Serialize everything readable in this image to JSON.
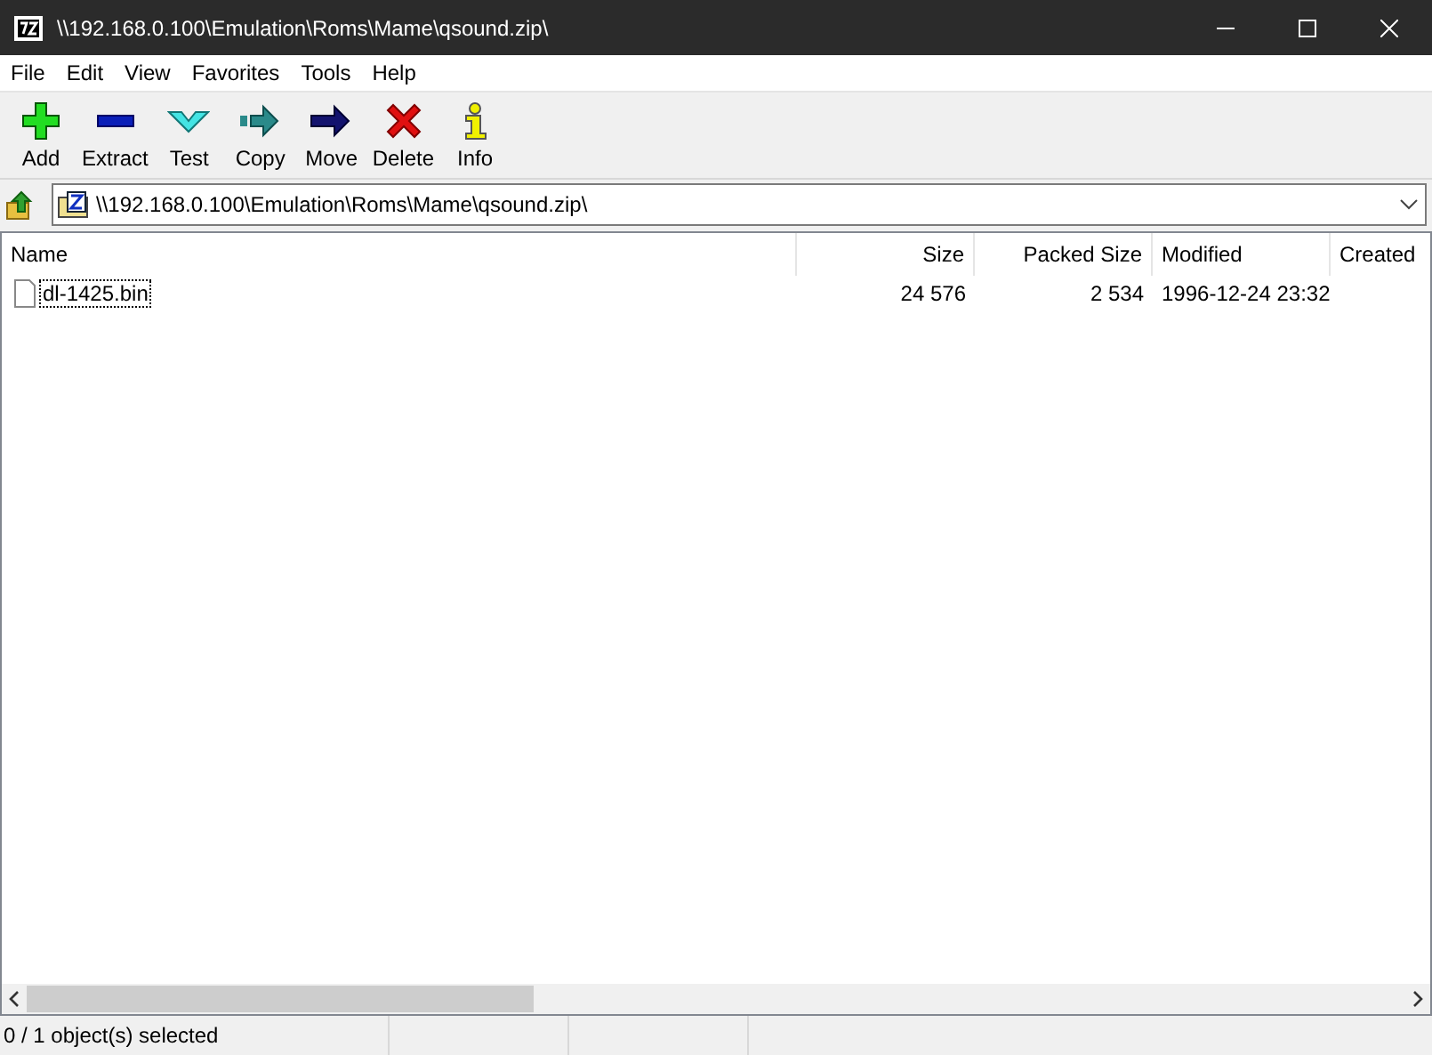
{
  "window": {
    "title": "\\\\192.168.0.100\\Emulation\\Roms\\Mame\\qsound.zip\\"
  },
  "menu": [
    "File",
    "Edit",
    "View",
    "Favorites",
    "Tools",
    "Help"
  ],
  "toolbar": [
    {
      "kind": "add",
      "label": "Add"
    },
    {
      "kind": "extract",
      "label": "Extract"
    },
    {
      "kind": "test",
      "label": "Test"
    },
    {
      "kind": "copy",
      "label": "Copy"
    },
    {
      "kind": "move",
      "label": "Move"
    },
    {
      "kind": "delete",
      "label": "Delete"
    },
    {
      "kind": "info",
      "label": "Info"
    }
  ],
  "address": {
    "value": "\\\\192.168.0.100\\Emulation\\Roms\\Mame\\qsound.zip\\"
  },
  "table": {
    "columns": [
      "Name",
      "Size",
      "Packed Size",
      "Modified",
      "Created"
    ],
    "rows": [
      {
        "cells": [
          "dl-1425.bin",
          "24 576",
          "2 534",
          "1996-12-24 23:32"
        ],
        "focused": true,
        "selected": false
      }
    ]
  },
  "status_bar": "0 / 1 object(s) selected"
}
